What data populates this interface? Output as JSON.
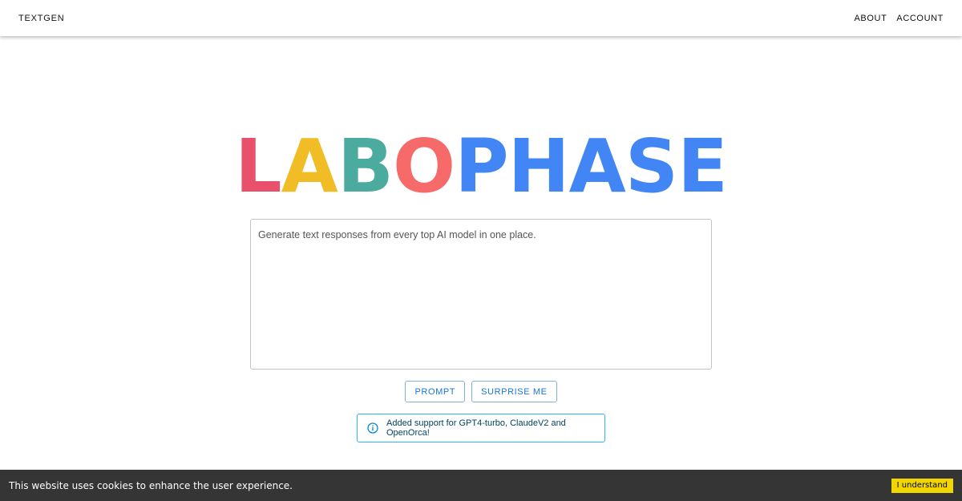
{
  "header": {
    "brand": "TEXTGEN",
    "nav": [
      {
        "label": "ABOUT"
      },
      {
        "label": "ACCOUNT"
      }
    ]
  },
  "logo": {
    "letters": [
      {
        "char": "L",
        "color": "#e9506b"
      },
      {
        "char": "A",
        "color": "#f1bd26"
      },
      {
        "char": "B",
        "color": "#4bab9f"
      },
      {
        "char": "O",
        "color": "#f76a6a"
      },
      {
        "char": "P",
        "color": "#4285f4"
      },
      {
        "char": "H",
        "color": "#4285f4"
      },
      {
        "char": "A",
        "color": "#4285f4"
      },
      {
        "char": "S",
        "color": "#4285f4"
      },
      {
        "char": "E",
        "color": "#4285f4"
      }
    ]
  },
  "prompt": {
    "placeholder": "Generate text responses from every top AI model in one place.",
    "value": ""
  },
  "buttons": {
    "prompt_label": "PROMPT",
    "surprise_label": "SURPRISE ME"
  },
  "info": {
    "icon": "info-icon",
    "text": "Added support for GPT4-turbo, ClaudeV2 and OpenOrca!"
  },
  "cookie": {
    "text": "This website uses cookies to enhance the user experience.",
    "button_label": "I understand"
  }
}
